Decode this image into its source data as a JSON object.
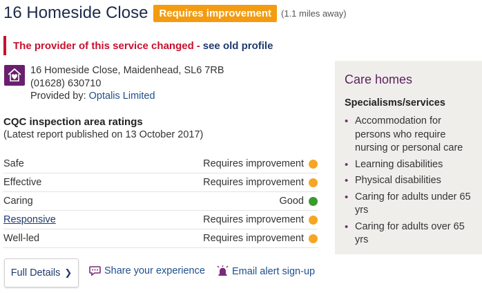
{
  "header": {
    "title": "16 Homeside Close",
    "badge": "Requires improvement",
    "distance": "(1.1 miles away)"
  },
  "alert": {
    "text": "The provider of this service changed",
    "separator": "-",
    "link": "see old profile"
  },
  "address": {
    "line": "16 Homeside Close, Maidenhead, SL6 7RB",
    "phone": "(01628) 630710",
    "provided_by_label": "Provided by:",
    "provider": "Optalis Limited"
  },
  "ratings": {
    "title": "CQC inspection area ratings",
    "subtitle": "(Latest report published on 13 October 2017)",
    "rows": [
      {
        "name": "Safe",
        "rating": "Requires improvement",
        "color": "#f5a623"
      },
      {
        "name": "Effective",
        "rating": "Requires improvement",
        "color": "#f5a623"
      },
      {
        "name": "Caring",
        "rating": "Good",
        "color": "#3a9a2c"
      },
      {
        "name": "Responsive",
        "rating": "Requires improvement",
        "color": "#f5a623"
      },
      {
        "name": "Well-led",
        "rating": "Requires improvement",
        "color": "#f5a623"
      }
    ]
  },
  "actions": {
    "full_details": "Full Details",
    "share": "Share your experience",
    "email_alert": "Email alert sign-up"
  },
  "care_box": {
    "title": "Care homes",
    "spec_title": "Specialisms/services",
    "items": [
      "Accommodation for persons who require nursing or personal care",
      "Learning disabilities",
      "Physical disabilities",
      "Caring for adults under 65 yrs",
      "Caring for adults over 65 yrs"
    ]
  },
  "colors": {
    "badge": "#f39c12",
    "alert": "#c8102e",
    "link": "#1f3a6e",
    "care_title": "#5a1f5c",
    "good": "#3a9a2c",
    "requires_improvement": "#f5a623"
  },
  "icons": {
    "address": "care-home-icon",
    "share": "speech-bubble-icon",
    "email": "alarm-bell-icon",
    "full_details": "chevron-right-icon"
  }
}
